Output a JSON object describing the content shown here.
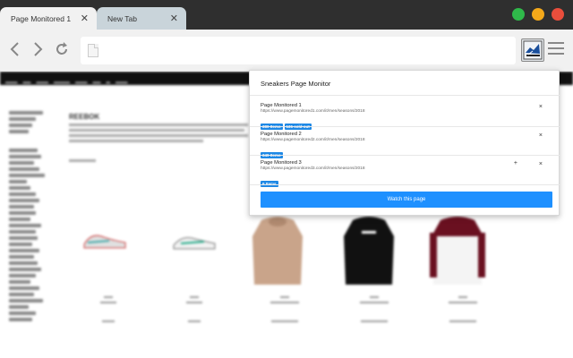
{
  "browser": {
    "tabs": [
      {
        "title": "Page Monitored 1",
        "active": true
      },
      {
        "title": "New Tab",
        "active": false
      }
    ],
    "window_controls": {
      "green": "#2fb94a",
      "yellow": "#f4a91a",
      "red": "#ea4e3c"
    },
    "address": "",
    "extension_icon": "sneakers-monitor-icon"
  },
  "page": {
    "heading": "REEBOK"
  },
  "popup": {
    "title": "Sneakers Page Monitor",
    "entries": [
      {
        "name": "Page Monitored 1",
        "url": "https://www.pagemonitored1.com/it/men/seasons/2018",
        "badges": [
          "380 Items",
          "136 sold out"
        ]
      },
      {
        "name": "Page Monitored 2",
        "url": "https://www.pagemonitored2.com/it/men/seasons/2018",
        "badges": [
          "349 Items"
        ]
      },
      {
        "name": "Page Monitored 3",
        "url": "https://www.pagemonitored3.com/it/men/seasons/2018",
        "badges": [
          "6 Items"
        ]
      }
    ],
    "close_glyph": "×",
    "plus_glyph": "+",
    "watch_button": "Watch this page",
    "accent": "#1e90ff"
  }
}
